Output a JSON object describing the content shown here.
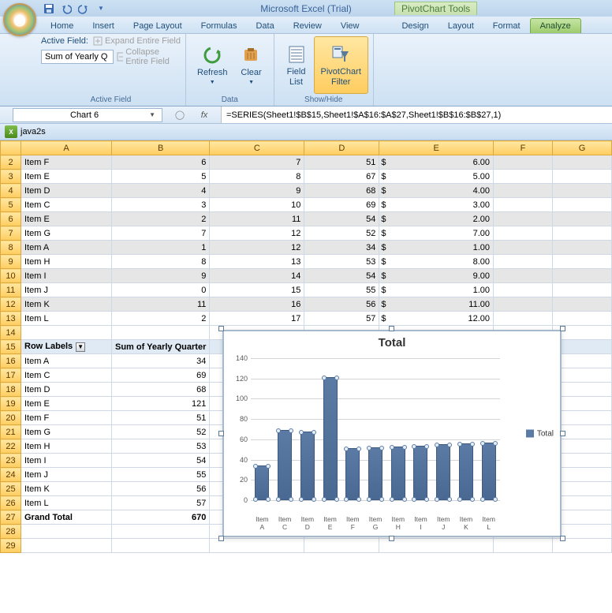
{
  "app_title": "Microsoft Excel (Trial)",
  "context_title": "PivotChart Tools",
  "tabs": [
    "Home",
    "Insert",
    "Page Layout",
    "Formulas",
    "Data",
    "Review",
    "View",
    "Design",
    "Layout",
    "Format",
    "Analyze"
  ],
  "active_tab_index": 10,
  "ribbon": {
    "active_field": {
      "label": "Active Field:",
      "value": "Sum of Yearly Q",
      "expand": "Expand Entire Field",
      "collapse": "Collapse Entire Field",
      "group": "Active Field"
    },
    "data": {
      "refresh": "Refresh",
      "clear": "Clear",
      "group": "Data"
    },
    "showhide": {
      "fieldlist": "Field\nList",
      "pcfilter": "PivotChart\nFilter",
      "group": "Show/Hide"
    }
  },
  "name_box": "Chart 6",
  "formula": "=SERIES(Sheet1!$B$15,Sheet1!$A$16:$A$27,Sheet1!$B$16:$B$27,1)",
  "workbook": "java2s",
  "columns": [
    "A",
    "B",
    "C",
    "D",
    "E",
    "F",
    "G"
  ],
  "row_start": 2,
  "table_rows": [
    {
      "a": "Item F",
      "b": 6,
      "c": 7,
      "d": 51,
      "e": "6.00",
      "band": true
    },
    {
      "a": "Item E",
      "b": 5,
      "c": 8,
      "d": 67,
      "e": "5.00",
      "band": false
    },
    {
      "a": "Item D",
      "b": 4,
      "c": 9,
      "d": 68,
      "e": "4.00",
      "band": true
    },
    {
      "a": "Item C",
      "b": 3,
      "c": 10,
      "d": 69,
      "e": "3.00",
      "band": false
    },
    {
      "a": "Item E",
      "b": 2,
      "c": 11,
      "d": 54,
      "e": "2.00",
      "band": true
    },
    {
      "a": "Item G",
      "b": 7,
      "c": 12,
      "d": 52,
      "e": "7.00",
      "band": false
    },
    {
      "a": "Item A",
      "b": 1,
      "c": 12,
      "d": 34,
      "e": "1.00",
      "band": true
    },
    {
      "a": "Item H",
      "b": 8,
      "c": 13,
      "d": 53,
      "e": "8.00",
      "band": false
    },
    {
      "a": "Item I",
      "b": 9,
      "c": 14,
      "d": 54,
      "e": "9.00",
      "band": true
    },
    {
      "a": "Item J",
      "b": 0,
      "c": 15,
      "d": 55,
      "e": "1.00",
      "band": false
    },
    {
      "a": "Item K",
      "b": 11,
      "c": 16,
      "d": 56,
      "e": "11.00",
      "band": true
    },
    {
      "a": "Item L",
      "b": 2,
      "c": 17,
      "d": 57,
      "e": "12.00",
      "band": false
    }
  ],
  "pivot": {
    "hdr_rowlabels": "Row Labels",
    "hdr_sum": "Sum of Yearly Quarter",
    "rows": [
      {
        "label": "Item A",
        "val": 34
      },
      {
        "label": "Item C",
        "val": 69
      },
      {
        "label": "Item D",
        "val": 68
      },
      {
        "label": "Item E",
        "val": 121
      },
      {
        "label": "Item F",
        "val": 51
      },
      {
        "label": "Item G",
        "val": 52
      },
      {
        "label": "Item H",
        "val": 53
      },
      {
        "label": "Item I",
        "val": 54
      },
      {
        "label": "Item J",
        "val": 55
      },
      {
        "label": "Item K",
        "val": 56
      },
      {
        "label": "Item L",
        "val": 57
      }
    ],
    "grand_label": "Grand Total",
    "grand_val": 670
  },
  "chart_data": {
    "type": "bar",
    "title": "Total",
    "series": [
      {
        "name": "Total",
        "values": [
          34,
          69,
          68,
          121,
          51,
          52,
          53,
          54,
          55,
          56,
          57
        ]
      }
    ],
    "categories": [
      "Item A",
      "Item C",
      "Item D",
      "Item E",
      "Item F",
      "Item G",
      "Item H",
      "Item I",
      "Item J",
      "Item K",
      "Item L"
    ],
    "ylabel": "",
    "xlabel": "",
    "ylim": [
      0,
      140
    ],
    "yticks": [
      0,
      20,
      40,
      60,
      80,
      100,
      120,
      140
    ]
  },
  "currency_symbol": "$",
  "dropdown_glyph": "▼"
}
